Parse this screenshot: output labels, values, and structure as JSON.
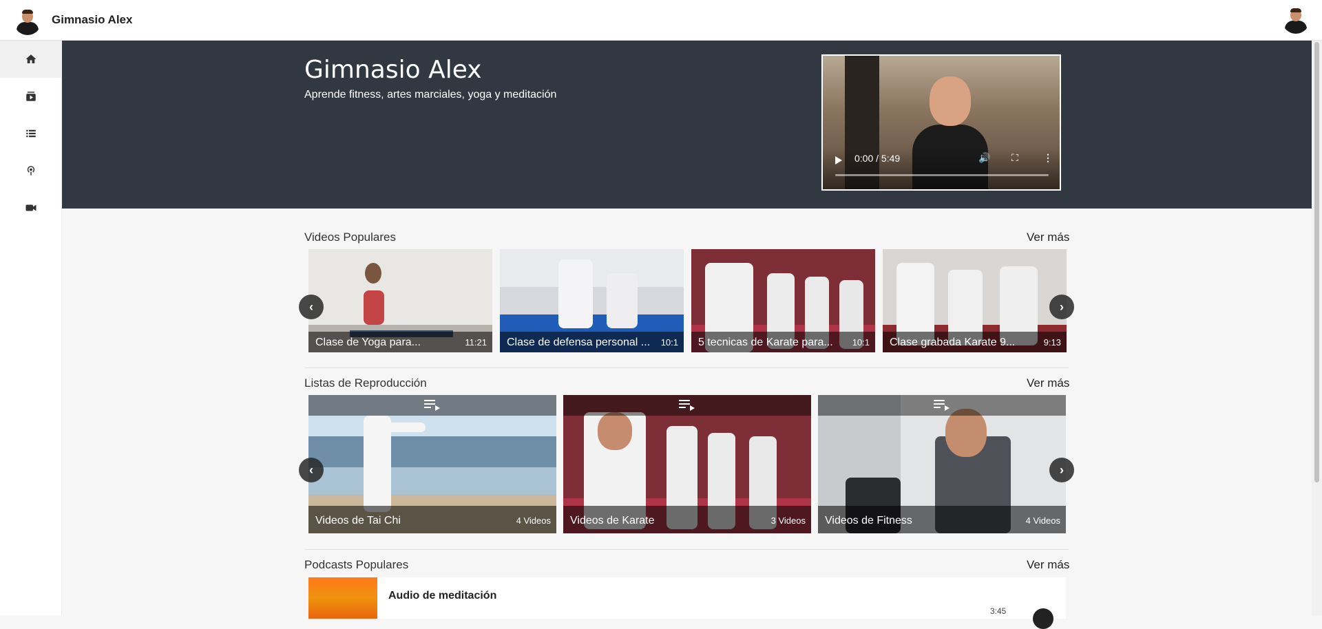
{
  "header": {
    "brand": "Gimnasio Alex",
    "logo_icon": "avatar",
    "user_icon": "avatar"
  },
  "sidebar": {
    "items": [
      {
        "icon": "home-icon",
        "active": true
      },
      {
        "icon": "video-library-icon",
        "active": false
      },
      {
        "icon": "list-icon",
        "active": false
      },
      {
        "icon": "podcast-icon",
        "active": false
      },
      {
        "icon": "camera-icon",
        "active": false
      }
    ]
  },
  "hero": {
    "title": "Gimnasio Alex",
    "subtitle": "Aprende fitness, artes marciales, yoga y meditación",
    "video_time": "0:00 / 5:49"
  },
  "popular_videos": {
    "title": "Videos Populares",
    "more": "Ver más",
    "items": [
      {
        "title": "Clase de Yoga para...",
        "duration": "11:21"
      },
      {
        "title": "Clase de defensa personal ...",
        "duration": "10:1"
      },
      {
        "title": "5 tecnicas de Karate para...",
        "duration": "10:1"
      },
      {
        "title": "Clase grabada Karate 9...",
        "duration": "9:13"
      }
    ]
  },
  "playlists": {
    "title": "Listas de Reproducción",
    "more": "Ver más",
    "items": [
      {
        "title": "Videos de Tai Chi",
        "count": "4 Videos"
      },
      {
        "title": "Videos de Karate",
        "count": "3 Videos"
      },
      {
        "title": "Videos de Fitness",
        "count": "4 Videos"
      }
    ]
  },
  "podcasts": {
    "title": "Podcasts Populares",
    "more": "Ver más",
    "items": [
      {
        "title": "Audio de meditación",
        "duration": "3:45"
      }
    ]
  },
  "colors": {
    "hero_bg": "#323841",
    "page_bg": "#f6f6f6"
  }
}
